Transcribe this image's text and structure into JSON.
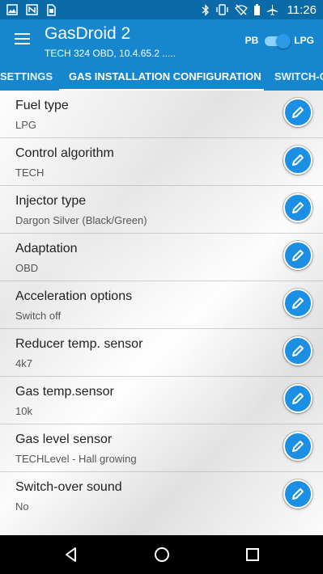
{
  "status_bar": {
    "time": "11:26",
    "left_icons": [
      "image-icon",
      "nfc-icon",
      "sim-icon"
    ],
    "right_icons": [
      "bluetooth-icon",
      "vibrate-icon",
      "wifi-off-icon",
      "battery-icon",
      "airplane-icon"
    ]
  },
  "app": {
    "title": "GasDroid 2",
    "subtitle": "TECH 324 OBD, 10.4.65.2 .....",
    "toggle_left": "PB",
    "toggle_right": "LPG",
    "toggle_state": "LPG"
  },
  "tabs": [
    {
      "label": "SETTINGS"
    },
    {
      "label": "GAS INSTALLATION CONFIGURATION",
      "active": true
    },
    {
      "label": "SWITCH-O"
    }
  ],
  "settings": [
    {
      "title": "Fuel type",
      "value": "LPG"
    },
    {
      "title": "Control algorithm",
      "value": "TECH"
    },
    {
      "title": "Injector type",
      "value": "Dargon Silver (Black/Green)"
    },
    {
      "title": "Adaptation",
      "value": "OBD"
    },
    {
      "title": "Acceleration options",
      "value": "Switch off"
    },
    {
      "title": "Reducer temp. sensor",
      "value": "4k7"
    },
    {
      "title": "Gas temp.sensor",
      "value": "10k"
    },
    {
      "title": "Gas level sensor",
      "value": "TECHLevel - Hall growing"
    },
    {
      "title": "Switch-over sound",
      "value": "No"
    }
  ],
  "colors": {
    "primary": "#1687cf",
    "status_bar": "#0b6aa8",
    "accent": "#1b8fe3"
  }
}
